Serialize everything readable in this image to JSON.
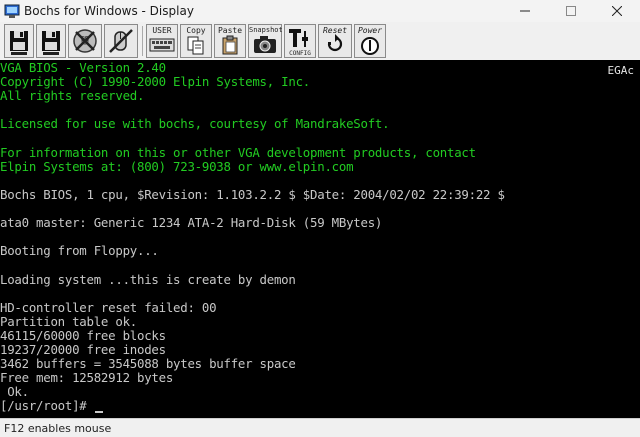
{
  "window": {
    "title": "Bochs for Windows - Display",
    "controls": {
      "minimize_icon": "minimize-icon",
      "maximize_icon": "maximize-icon",
      "close_icon": "close-icon"
    }
  },
  "toolbar": {
    "buttons": [
      {
        "id": "floppy-a",
        "icon": "floppy-disk-icon",
        "label": ""
      },
      {
        "id": "floppy-b",
        "icon": "floppy-disk-icon",
        "label": ""
      },
      {
        "id": "cdrom",
        "icon": "cd-disabled-icon",
        "label": "CD"
      },
      {
        "id": "mouse",
        "icon": "mouse-disabled-icon",
        "label": ""
      },
      {
        "id": "user",
        "icon": "keyboard-icon",
        "label": "USER"
      },
      {
        "id": "copy",
        "icon": "copy-icon",
        "label": "Copy"
      },
      {
        "id": "paste",
        "icon": "paste-icon",
        "label": "Paste"
      },
      {
        "id": "snapshot",
        "icon": "camera-icon",
        "label": "Snapshot"
      },
      {
        "id": "config",
        "icon": "config-icon",
        "label": "CONFIG"
      },
      {
        "id": "reset",
        "icon": "reset-icon",
        "label": "Reset"
      },
      {
        "id": "power",
        "icon": "power-icon",
        "label": "Power"
      }
    ]
  },
  "screen": {
    "corner_text": "EGAc",
    "lines": [
      {
        "text": "VGA BIOS - Version 2.40",
        "color": "green"
      },
      {
        "text": "Copyright (C) 1990-2000 Elpin Systems, Inc.",
        "color": "green"
      },
      {
        "text": "All rights reserved.",
        "color": "green"
      },
      {
        "text": "",
        "color": "green"
      },
      {
        "text": "Licensed for use with bochs, courtesy of MandrakeSoft.",
        "color": "green"
      },
      {
        "text": "",
        "color": "green"
      },
      {
        "text": "For information on this or other VGA development products, contact",
        "color": "green"
      },
      {
        "text": "Elpin Systems at: (800) 723-9038 or www.elpin.com",
        "color": "green"
      },
      {
        "text": "",
        "color": "white"
      },
      {
        "text": "Bochs BIOS, 1 cpu, $Revision: 1.103.2.2 $ $Date: 2004/02/02 22:39:22 $",
        "color": "white"
      },
      {
        "text": "",
        "color": "white"
      },
      {
        "text": "ata0 master: Generic 1234 ATA-2 Hard-Disk (59 MBytes)",
        "color": "white"
      },
      {
        "text": "",
        "color": "white"
      },
      {
        "text": "Booting from Floppy...",
        "color": "white"
      },
      {
        "text": "",
        "color": "white"
      },
      {
        "text": "Loading system ...this is create by demon",
        "color": "white"
      },
      {
        "text": "",
        "color": "white"
      },
      {
        "text": "HD-controller reset failed: 00",
        "color": "white"
      },
      {
        "text": "Partition table ok.",
        "color": "white"
      },
      {
        "text": "46115/60000 free blocks",
        "color": "white"
      },
      {
        "text": "19237/20000 free inodes",
        "color": "white"
      },
      {
        "text": "3462 buffers = 3545088 bytes buffer space",
        "color": "white"
      },
      {
        "text": "Free mem: 12582912 bytes",
        "color": "white"
      },
      {
        "text": " Ok.",
        "color": "white"
      },
      {
        "text": "[/usr/root]# ",
        "color": "white"
      }
    ]
  },
  "statusbar": {
    "text": "F12 enables mouse"
  },
  "colors": {
    "console_green": "#22cc22",
    "console_white": "#c8c8c8",
    "console_bg": "#000000"
  }
}
